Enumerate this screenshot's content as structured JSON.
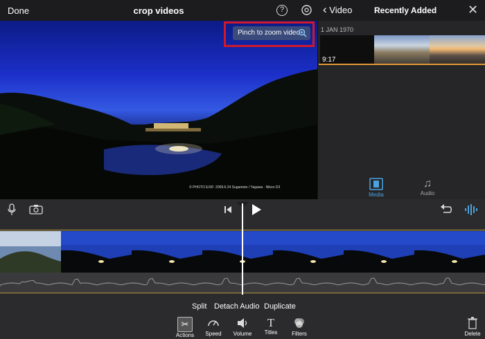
{
  "topbar": {
    "done": "Done",
    "title": "crop videos"
  },
  "viewer": {
    "hint": "Pinch to zoom video",
    "watermark": "© PHOTO EXIF: 2009.6.24 Sugamoto / Yagawa · Nikon D3"
  },
  "side": {
    "back": "Video",
    "title": "Recently Added",
    "date": "1 JAN 1970",
    "duration": "9:17",
    "tabs": [
      {
        "label": "Media"
      },
      {
        "label": "Audio"
      }
    ]
  },
  "actions": {
    "split": "Split",
    "detach": "Detach Audio",
    "duplicate": "Duplicate"
  },
  "bottom_tools": [
    {
      "label": "Actions"
    },
    {
      "label": "Speed"
    },
    {
      "label": "Volume"
    },
    {
      "label": "Titles"
    },
    {
      "label": "Filters"
    }
  ],
  "delete": "Delete",
  "colors": {
    "accent": "#e99a3a",
    "highlight": "#d1192a",
    "active_tab": "#4aa3df"
  }
}
